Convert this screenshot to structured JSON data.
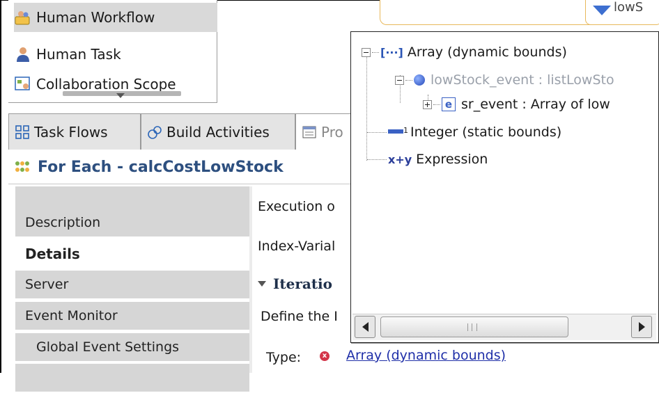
{
  "palette": {
    "items": [
      {
        "label": "Human Workflow",
        "icon": "human-workflow-icon",
        "selected": true
      },
      {
        "label": "Human Task",
        "icon": "human-task-icon",
        "selected": false
      },
      {
        "label": "Collaboration Scope",
        "icon": "collaboration-scope-icon",
        "selected": false
      }
    ]
  },
  "diagram": {
    "node_label": "lowS"
  },
  "tabs": [
    {
      "label": "Task Flows",
      "icon": "task-flows-icon"
    },
    {
      "label": "Build Activities",
      "icon": "build-activities-icon"
    },
    {
      "label": "Pro",
      "icon": "properties-icon"
    }
  ],
  "section": {
    "title": "For Each - calcCostLowStock"
  },
  "nav": {
    "items": [
      {
        "label": ""
      },
      {
        "label": "Description"
      },
      {
        "label": "Details",
        "active": true
      },
      {
        "label": "Server"
      },
      {
        "label": "Event Monitor"
      },
      {
        "label": "Global Event Settings",
        "sub": true
      },
      {
        "label": ""
      }
    ]
  },
  "content": {
    "execution_label": "Execution o",
    "index_variable_label": "Index-Varial",
    "iteration_header": "Iteratio",
    "define_text": "Define the I",
    "type_label": "Type:",
    "type_value": "Array (dynamic bounds)"
  },
  "popup": {
    "tree": {
      "array_dynamic": "Array (dynamic bounds)",
      "lowstock_event": "lowStock_event : listLowSto",
      "sr_event": "sr_event : Array of low",
      "integer_static": "Integer (static bounds)",
      "expression": "Expression"
    },
    "scrollbar": {
      "position": 0.1
    }
  },
  "colors": {
    "link": "#1f2fa8",
    "section_title": "#2d4f7f",
    "nav_bg": "#d6d6d6",
    "error": "#d3364a"
  }
}
